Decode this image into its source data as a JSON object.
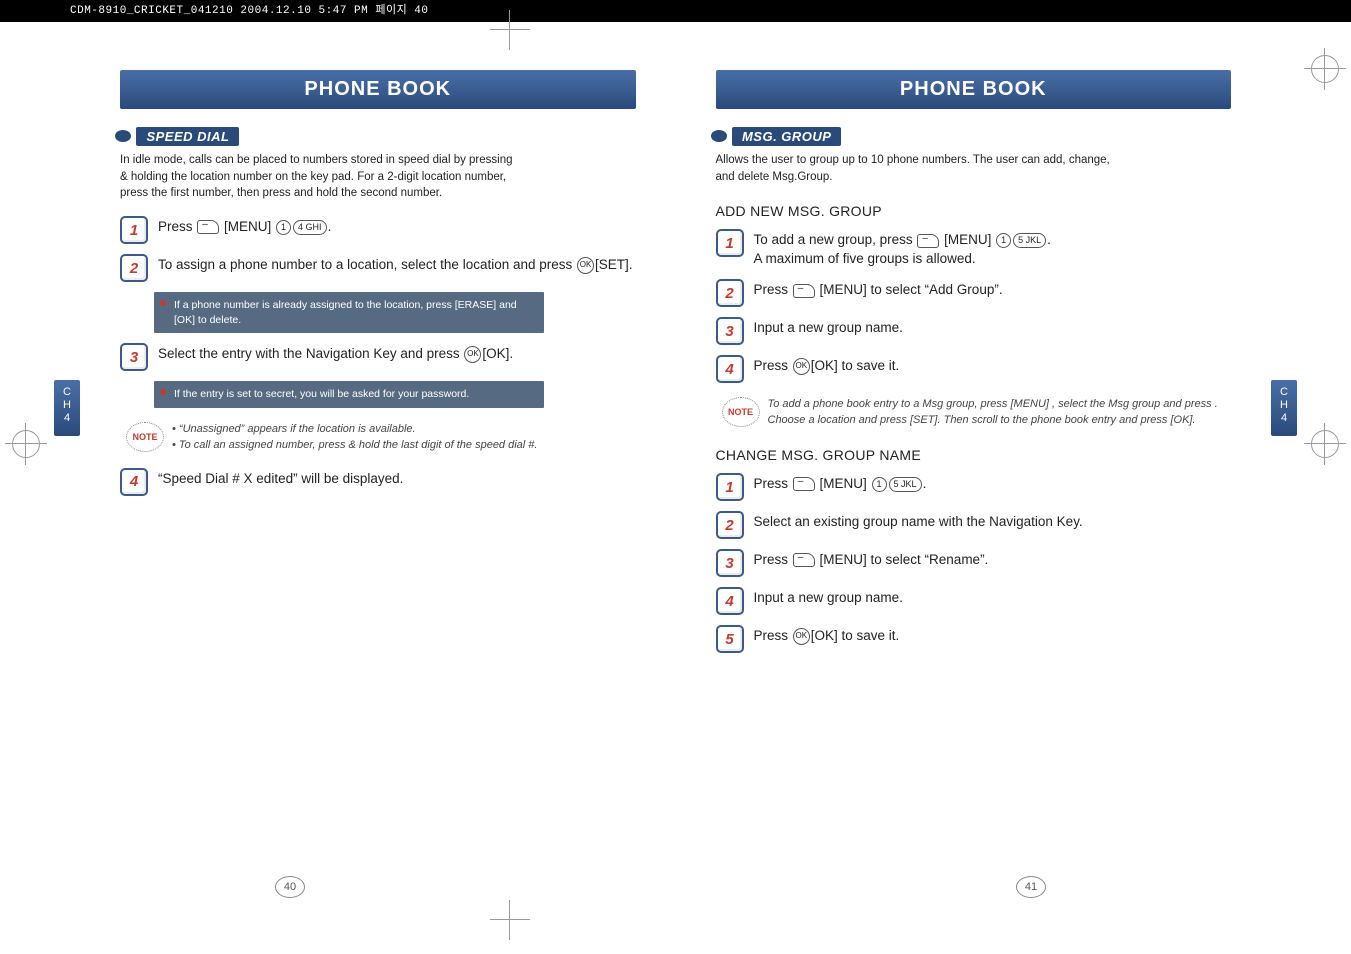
{
  "docHeader": "CDM-8910_CRICKET_041210  2004.12.10 5:47 PM  페이지 40",
  "left": {
    "chapterTitle": "PHONE BOOK",
    "chBadge": "C\nH\n4",
    "pageNum": "40",
    "section": "SPEED DIAL",
    "intro": "In idle mode, calls can be placed to numbers stored in speed dial by pressing & holding the location number on the key pad. For a 2-digit location number, press the first number, then press and hold the second number.",
    "steps": {
      "s1": "Press        [MENU]            .",
      "s2": "To assign a phone number to a location, select the location and press      [SET].",
      "s2note": "If a phone number is already assigned to the location, press       [ERASE] and       [OK] to delete.",
      "s3": "Select the entry with the Navigation Key and press      [OK].",
      "s3note": "If the entry is set to secret, you will be asked for your password.",
      "s4": "“Speed Dial # X edited” will be displayed."
    },
    "note1": "“Unassigned” appears if the location is available.",
    "note2": "To call an assigned number, press & hold the last digit of the speed dial #."
  },
  "right": {
    "chapterTitle": "PHONE BOOK",
    "chBadge": "C\nH\n4",
    "pageNum": "41",
    "section": "MSG. GROUP",
    "intro": "Allows the user to group up to 10 phone numbers. The user can add, change, and delete Msg.Group.",
    "sub1": "ADD NEW MSG. GROUP",
    "addSteps": {
      "s1": "To add a new group, press        [MENU]            . A maximum of five groups is allowed.",
      "s2": "Press        [MENU] to select “Add Group”.",
      "s3": "Input a new group name.",
      "s4": "Press      [OK] to save it."
    },
    "addNote": "To add a phone book entry to a Msg group, press        [MENU]             , select the Msg group and press       . Choose a location and press       [SET].  Then scroll to the phone book entry and press       [OK].",
    "sub2": "CHANGE MSG. GROUP NAME",
    "chgSteps": {
      "s1": "Press        [MENU]            .",
      "s2": "Select an existing group name with the Navigation Key.",
      "s3": "Press        [MENU] to select “Rename”.",
      "s4": "Input a new group name.",
      "s5": "Press      [OK] to save it."
    }
  },
  "keys": {
    "menu_soft": "–",
    "ok": "OK",
    "k1": "1",
    "k4": "4 GHI",
    "k5": "5 JKL"
  }
}
